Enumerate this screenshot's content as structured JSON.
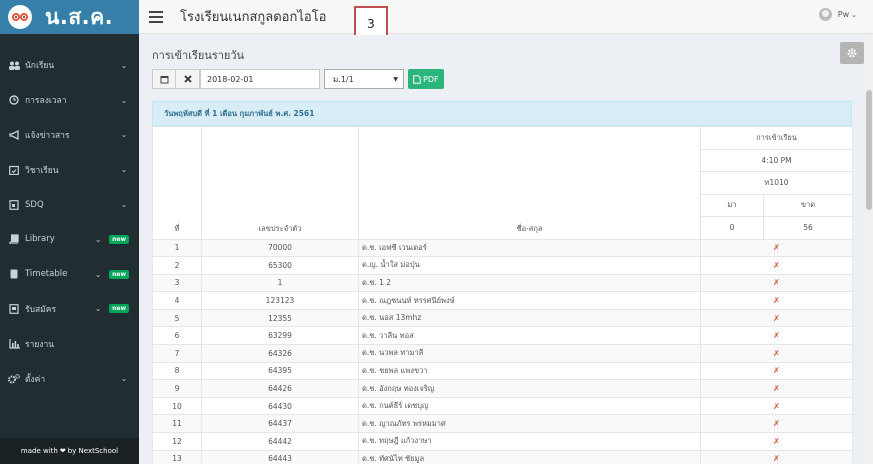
{
  "app": {
    "name": "น.ส.ค.",
    "logo_icon": "owl-logo-icon"
  },
  "header": {
    "school_name": "โรงเรียนเนกสกูลดอกไอโอ",
    "page_number": "3",
    "user_name": "Pw"
  },
  "sidebar": {
    "items": [
      {
        "label": "นักเรียน",
        "icon": "students-icon",
        "badge": ""
      },
      {
        "label": "การลงเวลา",
        "icon": "clock-icon",
        "badge": ""
      },
      {
        "label": "แจ้งข่าวสาร",
        "icon": "megaphone-icon",
        "badge": ""
      },
      {
        "label": "วิชาเรียน",
        "icon": "calendar-check-icon",
        "badge": ""
      },
      {
        "label": "SDQ",
        "icon": "book-icon",
        "badge": ""
      },
      {
        "label": "Library",
        "icon": "library-icon",
        "badge": "new"
      },
      {
        "label": "Timetable",
        "icon": "timetable-icon",
        "badge": "new"
      },
      {
        "label": "รับสมัคร",
        "icon": "register-icon",
        "badge": "new"
      },
      {
        "label": "รายงาน",
        "icon": "bar-chart-icon",
        "badge": ""
      },
      {
        "label": "ตั้งค่า",
        "icon": "cogs-icon",
        "badge": ""
      }
    ],
    "footer": {
      "prefix": "made with",
      "suffix": "by NextSchool"
    }
  },
  "main": {
    "title": "การเข้าเรียนรายวัน",
    "filters": {
      "date_value": "2018-02-01",
      "class_value": "ม.1/1",
      "pdf_label": "PDF"
    },
    "report_header": "วันพฤหัสบดี ที่ 1 เดือน กุมภาพันธ์ พ.ศ. 2561",
    "table": {
      "col_no": "ที่",
      "col_student_id": "เลขประจำตัว",
      "col_name": "ชื่อ-สกุล",
      "attendance_label": "การเข้าเรียน",
      "time": "4:10 PM",
      "subject": "ท1010",
      "present_label": "มา",
      "absent_label": "ขาด",
      "present_count": "0",
      "absent_count": "56",
      "absent_mark": "✗",
      "rows": [
        {
          "no": "1",
          "id": "70000",
          "name": "ด.ช. เอฟซี เวนเดอร์"
        },
        {
          "no": "2",
          "id": "65300",
          "name": "ด.ญ. น้ำใส ม่อปุ่น"
        },
        {
          "no": "3",
          "id": "1",
          "name": "ด.ช. 1 2"
        },
        {
          "no": "4",
          "id": "123123",
          "name": "ด.ช. ณฎชนนท์ ทรรศนีย์พงษ์"
        },
        {
          "no": "5",
          "id": "12355",
          "name": "ด.ช. นอส 13mhz"
        },
        {
          "no": "6",
          "id": "63299",
          "name": "ด.ช. วาลีน ทอส"
        },
        {
          "no": "7",
          "id": "64326",
          "name": "ด.ช. นวพล ทามาลี"
        },
        {
          "no": "8",
          "id": "64395",
          "name": "ด.ช. ชยพล แพงขวา"
        },
        {
          "no": "9",
          "id": "64426",
          "name": "ด.ช. อังกฤษ ทองเจริญ"
        },
        {
          "no": "10",
          "id": "64430",
          "name": "ด.ช. กนต์ธีร์ เดชบุญ"
        },
        {
          "no": "11",
          "id": "64437",
          "name": "ด.ช. ญาณภัทร พรหมมาศ"
        },
        {
          "no": "12",
          "id": "64442",
          "name": "ด.ช. ทฤษฎี แก้วงาษา"
        },
        {
          "no": "13",
          "id": "64443",
          "name": "ด.ช. ทัศนัไท ชัยมูล"
        }
      ]
    }
  }
}
